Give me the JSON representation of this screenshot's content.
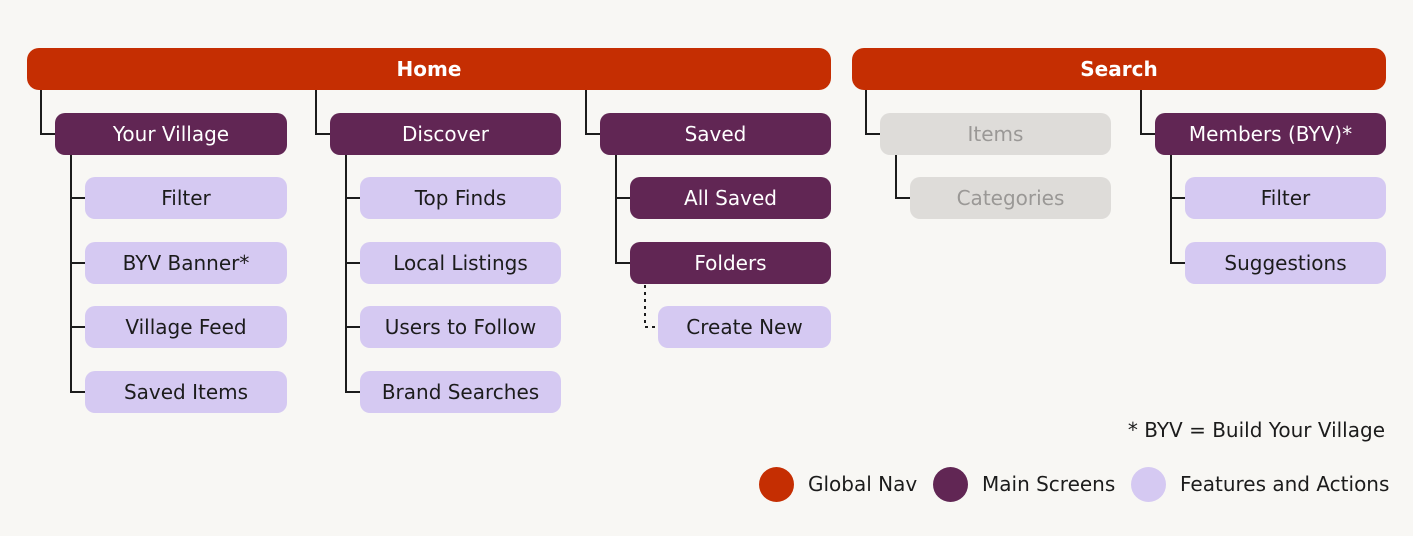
{
  "home": {
    "label": "Home",
    "your_village": {
      "label": "Your Village",
      "children": [
        "Filter",
        "BYV Banner*",
        "Village Feed",
        "Saved Items"
      ]
    },
    "discover": {
      "label": "Discover",
      "children": [
        "Top Finds",
        "Local Listings",
        "Users to Follow",
        "Brand Searches"
      ]
    },
    "saved": {
      "label": "Saved",
      "all_saved": "All Saved",
      "folders": "Folders",
      "create_new": "Create New"
    }
  },
  "search": {
    "label": "Search",
    "items": {
      "label": "Items",
      "categories": "Categories"
    },
    "members": {
      "label": "Members (BYV)*",
      "children": [
        "Filter",
        "Suggestions"
      ]
    }
  },
  "footnote": "* BYV = Build Your Village",
  "legend": [
    {
      "label": "Global Nav",
      "color": "#c52e02"
    },
    {
      "label": "Main Screens",
      "color": "#612654"
    },
    {
      "label": "Features and Actions",
      "color": "#d5c9f2"
    }
  ],
  "colors": {
    "global_nav": "#c52e02",
    "main_screen": "#612654",
    "feature": "#d5c9f2",
    "inactive": "#dedcd9",
    "inactive_text": "#9a9896",
    "background": "#f8f7f4",
    "connector": "#1c1c1c"
  }
}
